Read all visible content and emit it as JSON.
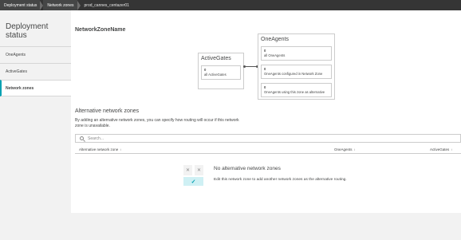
{
  "breadcrumb": {
    "items": [
      "Deployment status",
      "Network zones",
      "prod_cannes_centazer01"
    ]
  },
  "sidebar": {
    "title": "Deployment status",
    "items": [
      {
        "label": "OneAgents"
      },
      {
        "label": "ActiveGates"
      },
      {
        "label": "Network zones"
      }
    ]
  },
  "main": {
    "title": "NetworkZoneName",
    "activegates": {
      "title": "ActiveGates",
      "count": "0",
      "label": "all ActiveGates"
    },
    "oneagents": {
      "title": "OneAgents",
      "cards": [
        {
          "count": "0",
          "label": "all OneAgents"
        },
        {
          "count": "0",
          "label": "OneAgents configured in Network Zone"
        },
        {
          "count": "0",
          "label": "OneAgents using this zone as alternative"
        }
      ]
    },
    "alternative": {
      "title": "Alternative network zones",
      "description": "By adding an alternative network zones, you can specify how routing will occur if this network zone is unavailable."
    },
    "search": {
      "placeholder": "Search..."
    },
    "table": {
      "columns": [
        "Alternative network zone",
        "OneAgents",
        "ActiveGates"
      ],
      "sort_icon": "↕"
    },
    "empty": {
      "title": "No alternative network zones",
      "text": "Edit this network zone to add another network zones as the alternative routing.",
      "x_glyph": "✕",
      "check_glyph": "✓"
    }
  },
  "colors": {
    "accent": "#00a1b2",
    "header_bg": "#353535",
    "sidebar_bg": "#f2f2f2"
  }
}
